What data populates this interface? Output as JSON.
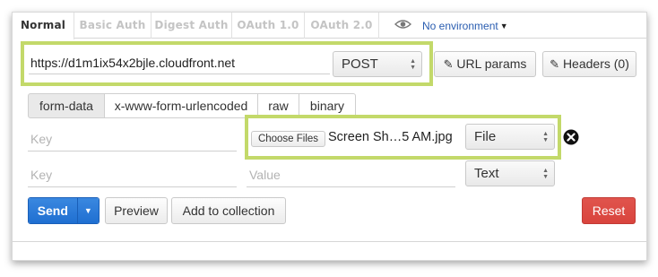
{
  "auth_tabs": [
    "Normal",
    "Basic Auth",
    "Digest Auth",
    "OAuth 1.0",
    "OAuth 2.0"
  ],
  "environment": {
    "label": "No environment"
  },
  "request": {
    "url": "https://d1m1ix54x2bjle.cloudfront.net",
    "method": "POST",
    "url_params_label": "URL params",
    "headers_label": "Headers (0)"
  },
  "body_tabs": [
    "form-data",
    "x-www-form-urlencoded",
    "raw",
    "binary"
  ],
  "form_rows": [
    {
      "key_placeholder": "Key",
      "choose_files_label": "Choose Files",
      "file_name": "Screen Sh…5 AM.jpg",
      "type": "File"
    },
    {
      "key_placeholder": "Key",
      "value_placeholder": "Value",
      "type": "Text"
    }
  ],
  "actions": {
    "send_label": "Send",
    "preview_label": "Preview",
    "add_collection_label": "Add to collection",
    "reset_label": "Reset"
  },
  "colors": {
    "highlight": "#c3d96a",
    "send": "#1f6fd1",
    "reset": "#d9443d",
    "link": "#2a5db0"
  }
}
